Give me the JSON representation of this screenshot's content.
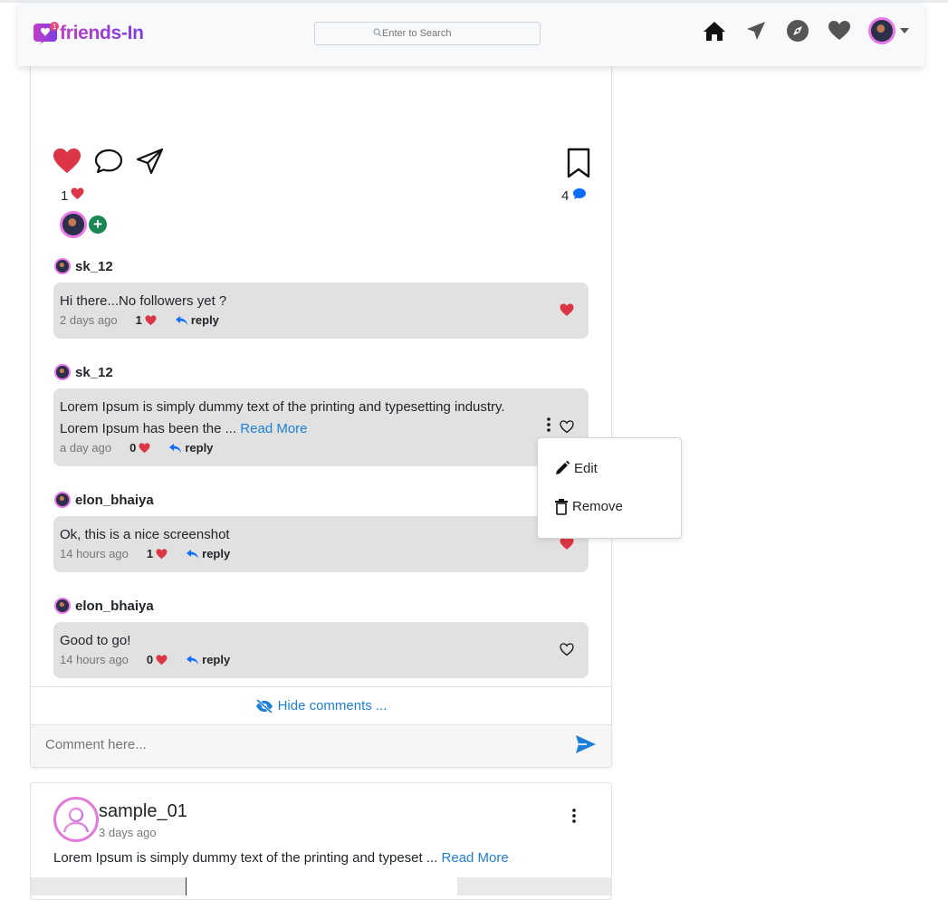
{
  "brand": {
    "name": "friends-In",
    "logo_icon": "heart-notification-icon"
  },
  "search": {
    "placeholder": "Enter to Search"
  },
  "nav": {
    "icons": [
      "home-icon",
      "send-icon",
      "compass-icon",
      "heart-icon"
    ],
    "profile": "avatar"
  },
  "post": {
    "likes_count": "1",
    "comments_count": "4",
    "comments": [
      {
        "user": "sk_12",
        "text": "Hi there...No followers yet ?",
        "read_more": "",
        "time": "2 days ago",
        "likes": "1",
        "reply": "reply",
        "liked": true
      },
      {
        "user": "sk_12",
        "text": "Lorem Ipsum is simply dummy text of the printing and typesetting industry. Lorem Ipsum has been the ...",
        "read_more": "Read More",
        "time": "a day ago",
        "likes": "0",
        "reply": "reply",
        "liked": false
      },
      {
        "user": "elon_bhaiya",
        "text": "Ok, this is a nice screenshot",
        "read_more": "",
        "time": "14 hours ago",
        "likes": "1",
        "reply": "reply",
        "liked": true
      },
      {
        "user": "elon_bhaiya",
        "text": "Good to go!",
        "read_more": "",
        "time": "14 hours ago",
        "likes": "0",
        "reply": "reply",
        "liked": false
      }
    ],
    "menu": {
      "edit": "Edit",
      "remove": "Remove"
    },
    "hide_comments": "Hide comments ...",
    "comment_placeholder": "Comment here..."
  },
  "next_post": {
    "user": "sample_01",
    "time": "3 days ago",
    "text": "Lorem Ipsum is simply dummy text of the printing and typeset ...",
    "read_more": "Read More"
  },
  "colors": {
    "accent": "#1e7fd6",
    "like": "#dc3545",
    "brand": "#b03ec2",
    "add": "#198754"
  }
}
